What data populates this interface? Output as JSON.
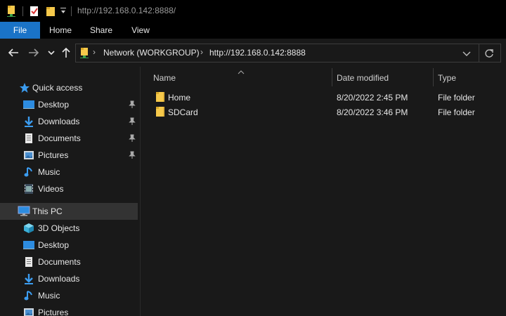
{
  "titlebar": {
    "title": "http://192.168.0.142:8888/"
  },
  "ribbon": {
    "tabs": [
      "File",
      "Home",
      "Share",
      "View"
    ]
  },
  "address": {
    "crumbs": [
      "Network (WORKGROUP)",
      "http://192.168.0.142:8888"
    ]
  },
  "navpane": {
    "quick_access": {
      "label": "Quick access",
      "items": [
        {
          "label": "Desktop",
          "icon": "desktop-icon",
          "pinned": true
        },
        {
          "label": "Downloads",
          "icon": "download-icon",
          "pinned": true
        },
        {
          "label": "Documents",
          "icon": "documents-icon",
          "pinned": true
        },
        {
          "label": "Pictures",
          "icon": "pictures-icon",
          "pinned": true
        },
        {
          "label": "Music",
          "icon": "music-icon",
          "pinned": false
        },
        {
          "label": "Videos",
          "icon": "videos-icon",
          "pinned": false
        }
      ]
    },
    "this_pc": {
      "label": "This PC",
      "items": [
        {
          "label": "3D Objects",
          "icon": "cube-icon"
        },
        {
          "label": "Desktop",
          "icon": "desktop-icon"
        },
        {
          "label": "Documents",
          "icon": "documents-icon"
        },
        {
          "label": "Downloads",
          "icon": "download-icon"
        },
        {
          "label": "Music",
          "icon": "music-icon"
        },
        {
          "label": "Pictures",
          "icon": "pictures-icon"
        }
      ]
    }
  },
  "filelist": {
    "columns": {
      "name": "Name",
      "date": "Date modified",
      "type": "Type"
    },
    "rows": [
      {
        "name": "Home",
        "date": "8/20/2022 2:45 PM",
        "type": "File folder"
      },
      {
        "name": "SDCard",
        "date": "8/20/2022 3:46 PM",
        "type": "File folder"
      }
    ]
  },
  "colors": {
    "accent": "#1a73c7",
    "folder": "#f6c94b",
    "background": "#191919",
    "selected": "#333333"
  }
}
